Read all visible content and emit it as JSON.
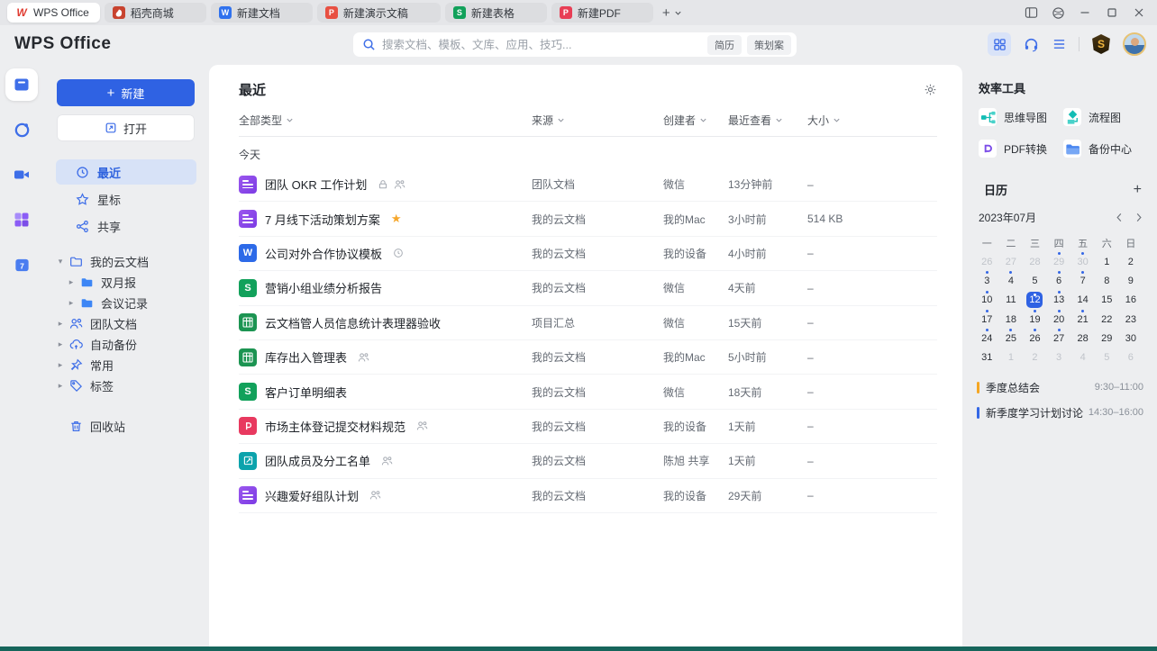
{
  "titlebar": {
    "tabs": [
      {
        "label": "WPS Office",
        "icon": "wps-logo",
        "active": true
      },
      {
        "label": "稻壳商城",
        "icon": "docer",
        "active": false
      },
      {
        "label": "新建文档",
        "icon": "writer",
        "active": false
      },
      {
        "label": "新建演示文稿",
        "icon": "presentation",
        "active": false
      },
      {
        "label": "新建表格",
        "icon": "spreadsheet",
        "active": false
      },
      {
        "label": "新建PDF",
        "icon": "pdf-tab",
        "active": false
      }
    ],
    "window_controls": [
      "sidebar-toggle",
      "workspace",
      "minimize",
      "maximize",
      "close"
    ]
  },
  "header": {
    "logo": "WPS Office",
    "search": {
      "placeholder": "搜索文档、模板、文库、应用、技巧...",
      "tags": [
        "简历",
        "策划案"
      ]
    },
    "right_icons": [
      "apps-grid",
      "support-headset",
      "task-list",
      "vip-badge",
      "avatar"
    ]
  },
  "rail": {
    "items": [
      "documents",
      "recent-clock",
      "meeting-video",
      "apps",
      "calendar-app"
    ]
  },
  "sidebar": {
    "new_label": "新建",
    "open_label": "打开",
    "nav": [
      {
        "label": "最近",
        "icon": "clock",
        "active": true
      },
      {
        "label": "星标",
        "icon": "star",
        "active": false
      },
      {
        "label": "共享",
        "icon": "share",
        "active": false
      }
    ],
    "tree": [
      {
        "label": "我的云文档",
        "icon": "folder-open",
        "level": 0,
        "expanded": true
      },
      {
        "label": "双月报",
        "icon": "folder-solid",
        "level": 1,
        "expanded": false
      },
      {
        "label": "会议记录",
        "icon": "folder-solid",
        "level": 1,
        "expanded": false
      },
      {
        "label": "团队文档",
        "icon": "team",
        "level": 0,
        "expanded": false
      },
      {
        "label": "自动备份",
        "icon": "cloud-backup",
        "level": 0,
        "expanded": false
      },
      {
        "label": "常用",
        "icon": "pin",
        "level": 0,
        "expanded": false
      },
      {
        "label": "标签",
        "icon": "tag",
        "level": 0,
        "expanded": false
      }
    ],
    "trash_label": "回收站"
  },
  "main": {
    "title": "最近",
    "filters": [
      "全部类型",
      "来源",
      "创建者",
      "最近查看",
      "大小"
    ],
    "group": "今天",
    "files": [
      {
        "name": "团队 OKR 工作计划",
        "icon": "doc-purple",
        "badges": [
          "lock",
          "people"
        ],
        "source": "团队文档",
        "creator": "微信",
        "viewed": "13分钟前",
        "size": "–"
      },
      {
        "name": "7 月线下活动策划方案",
        "icon": "doc-purple",
        "badges": [
          "star"
        ],
        "source": "我的云文档",
        "creator": "我的Mac",
        "viewed": "3小时前",
        "size": "514 KB"
      },
      {
        "name": "公司对外合作协议模板",
        "icon": "doc-word",
        "badges": [
          "clock"
        ],
        "source": "我的云文档",
        "creator": "我的设备",
        "viewed": "4小时前",
        "size": "–"
      },
      {
        "name": "营销小组业绩分析报告",
        "icon": "sheet-s",
        "badges": [],
        "source": "我的云文档",
        "creator": "微信",
        "viewed": "4天前",
        "size": "–"
      },
      {
        "name": "云文档管人员信息统计表理器验收",
        "icon": "sheet-grid",
        "badges": [],
        "source": "项目汇总",
        "creator": "微信",
        "viewed": "15天前",
        "size": "–"
      },
      {
        "name": "库存出入管理表",
        "icon": "sheet-grid",
        "badges": [
          "people"
        ],
        "source": "我的云文档",
        "creator": "我的Mac",
        "viewed": "5小时前",
        "size": "–"
      },
      {
        "name": "客户订单明细表",
        "icon": "sheet-s",
        "badges": [],
        "source": "我的云文档",
        "creator": "微信",
        "viewed": "18天前",
        "size": "–"
      },
      {
        "name": "市场主体登记提交材料规范",
        "icon": "pdf-file",
        "badges": [
          "people"
        ],
        "source": "我的云文档",
        "creator": "我的设备",
        "viewed": "1天前",
        "size": "–"
      },
      {
        "name": "团队成员及分工名单",
        "icon": "form-teal",
        "badges": [
          "people"
        ],
        "source": "我的云文档",
        "creator": "陈旭 共享",
        "viewed": "1天前",
        "size": "–"
      },
      {
        "name": "兴趣爱好组队计划",
        "icon": "doc-purple",
        "badges": [
          "people"
        ],
        "source": "我的云文档",
        "creator": "我的设备",
        "viewed": "29天前",
        "size": "–"
      }
    ]
  },
  "tools": {
    "title": "效率工具",
    "items": [
      {
        "label": "思维导图",
        "icon": "mindmap"
      },
      {
        "label": "流程图",
        "icon": "flowchart"
      },
      {
        "label": "PDF转换",
        "icon": "pdf-convert"
      },
      {
        "label": "备份中心",
        "icon": "backup-folder"
      }
    ]
  },
  "calendar": {
    "title": "日历",
    "month": "2023年07月",
    "day_headers": [
      "一",
      "二",
      "三",
      "四",
      "五",
      "六",
      "日"
    ],
    "weeks": [
      [
        {
          "d": "26",
          "muted": true
        },
        {
          "d": "27",
          "muted": true
        },
        {
          "d": "28",
          "muted": true
        },
        {
          "d": "29",
          "muted": true,
          "dot": true
        },
        {
          "d": "30",
          "muted": true,
          "dot": true
        },
        {
          "d": "1"
        },
        {
          "d": "2"
        }
      ],
      [
        {
          "d": "3",
          "dot": true
        },
        {
          "d": "4",
          "dot": true
        },
        {
          "d": "5"
        },
        {
          "d": "6",
          "dot": true
        },
        {
          "d": "7",
          "dot": true
        },
        {
          "d": "8"
        },
        {
          "d": "9"
        }
      ],
      [
        {
          "d": "10",
          "dot": true
        },
        {
          "d": "11"
        },
        {
          "d": "12",
          "selected": true,
          "dot": true
        },
        {
          "d": "13",
          "dot": true
        },
        {
          "d": "14"
        },
        {
          "d": "15"
        },
        {
          "d": "16"
        }
      ],
      [
        {
          "d": "17",
          "dot": true
        },
        {
          "d": "18"
        },
        {
          "d": "19",
          "dot": true
        },
        {
          "d": "20",
          "dot": true
        },
        {
          "d": "21",
          "dot": true
        },
        {
          "d": "22"
        },
        {
          "d": "23"
        }
      ],
      [
        {
          "d": "24",
          "dot": true
        },
        {
          "d": "25",
          "dot": true
        },
        {
          "d": "26",
          "dot": true
        },
        {
          "d": "27",
          "dot": true
        },
        {
          "d": "28"
        },
        {
          "d": "29"
        },
        {
          "d": "30"
        }
      ],
      [
        {
          "d": "31"
        },
        {
          "d": "1",
          "muted": true
        },
        {
          "d": "2",
          "muted": true
        },
        {
          "d": "3",
          "muted": true
        },
        {
          "d": "4",
          "muted": true
        },
        {
          "d": "5",
          "muted": true
        },
        {
          "d": "6",
          "muted": true
        }
      ]
    ],
    "events": [
      {
        "name": "季度总结会",
        "time": "9:30–11:00",
        "color": "#F5A623"
      },
      {
        "name": "新季度学习计划讨论",
        "time": "14:30–16:00",
        "color": "#3467E6"
      }
    ]
  },
  "colors": {
    "accent_blue": "#2F62E3",
    "selected_day_bg": "#2F62E3",
    "bottom_strip": "#16655B"
  }
}
